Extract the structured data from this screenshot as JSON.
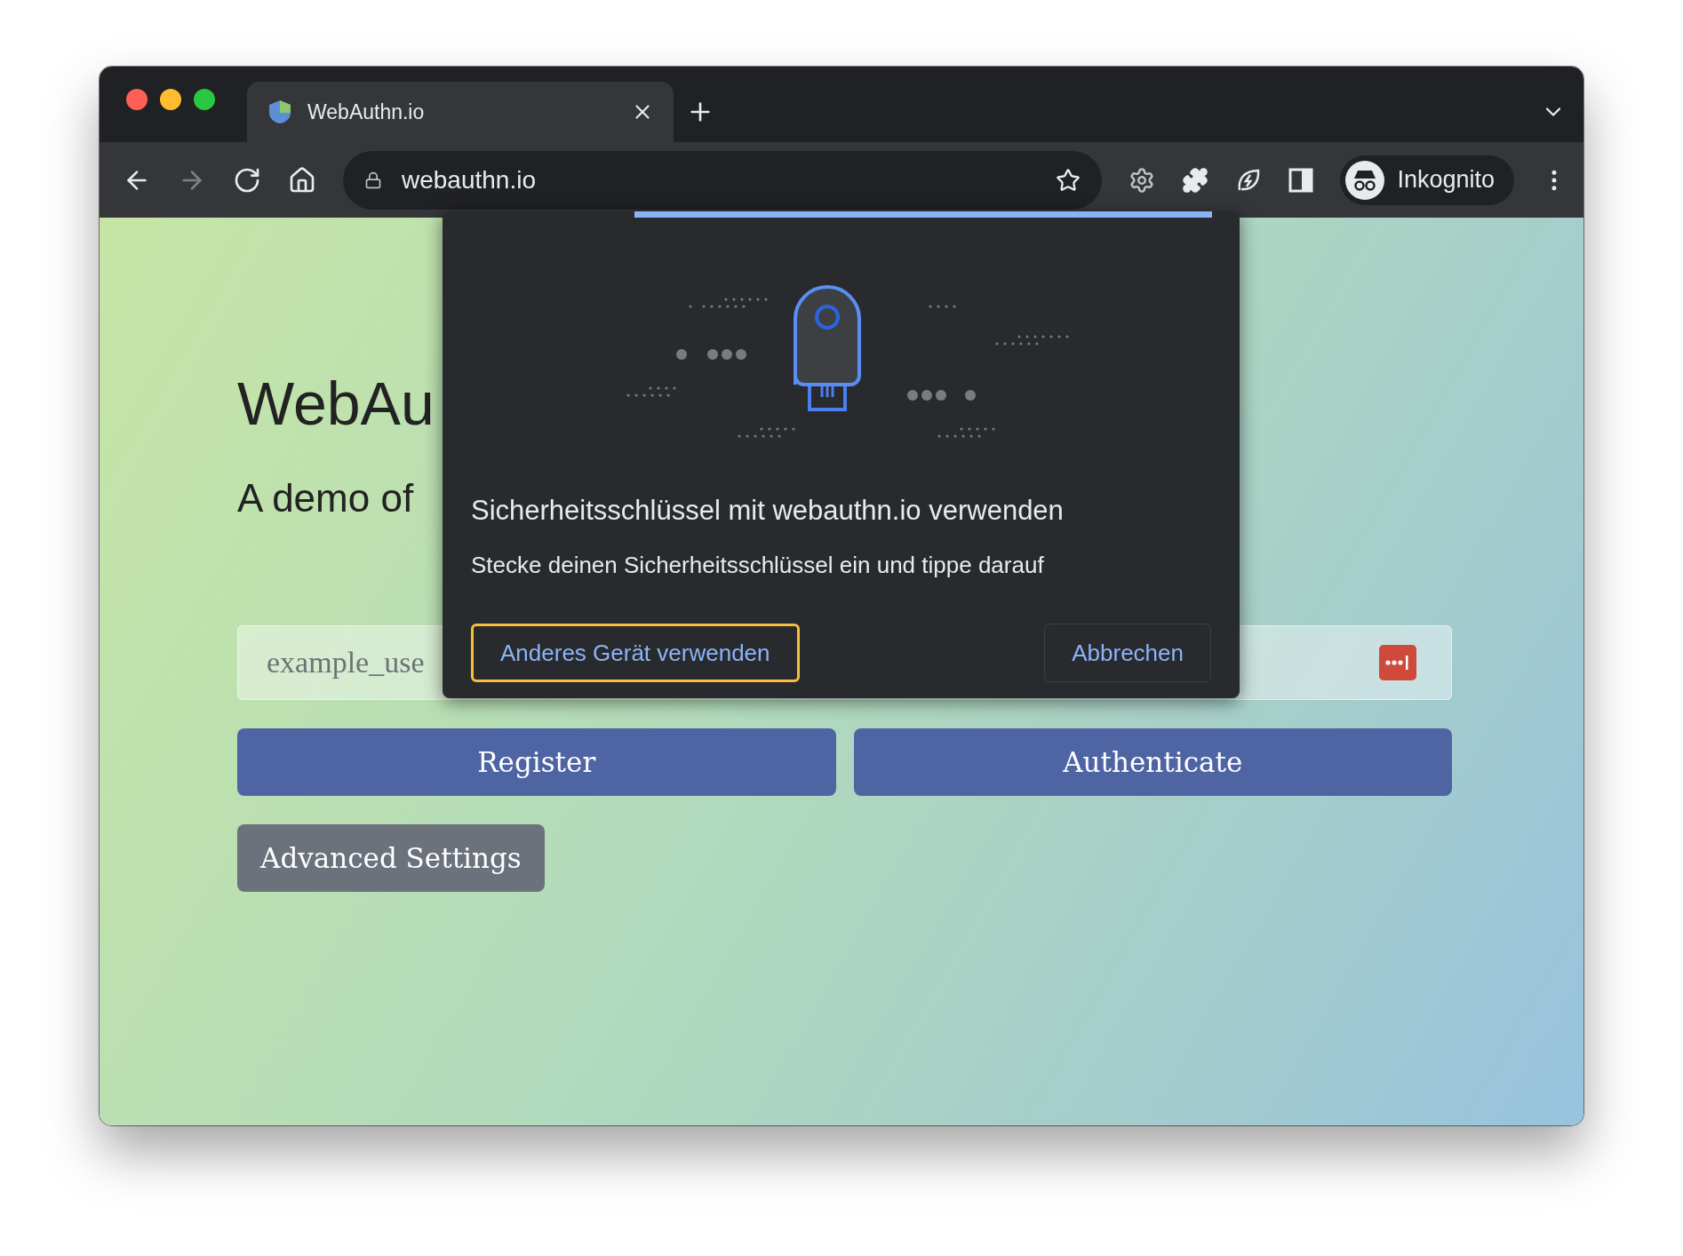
{
  "window": {
    "tabs": [
      {
        "title": "WebAuthn.io",
        "selected": true
      }
    ]
  },
  "toolbar": {
    "nav": [
      {
        "kind": "back",
        "disabled": false
      },
      {
        "kind": "forward",
        "disabled": true
      },
      {
        "kind": "reload",
        "disabled": false
      },
      {
        "kind": "home",
        "disabled": false
      }
    ],
    "url": "webauthn.io",
    "profile": "Inkognito"
  },
  "page": {
    "title": "WebAu",
    "subtitle": "A demo of",
    "username": {
      "placeholder": "example_use"
    },
    "buttons": [
      {
        "label": "Register",
        "kind": "primary"
      },
      {
        "label": "Authenticate",
        "kind": "primary"
      },
      {
        "label": "Advanced Settings",
        "kind": "secondary"
      }
    ]
  },
  "dialog": {
    "progress": {
      "level": 1
    },
    "title": "Sicherheitsschlüssel mit webauthn.io verwenden",
    "message": "Stecke deinen Sicherheitsschlüssel ein und tippe darauf",
    "buttons": [
      {
        "label": "Anderes Gerät verwenden",
        "focused": true
      },
      {
        "label": "Abbrechen",
        "focused": false
      }
    ]
  }
}
